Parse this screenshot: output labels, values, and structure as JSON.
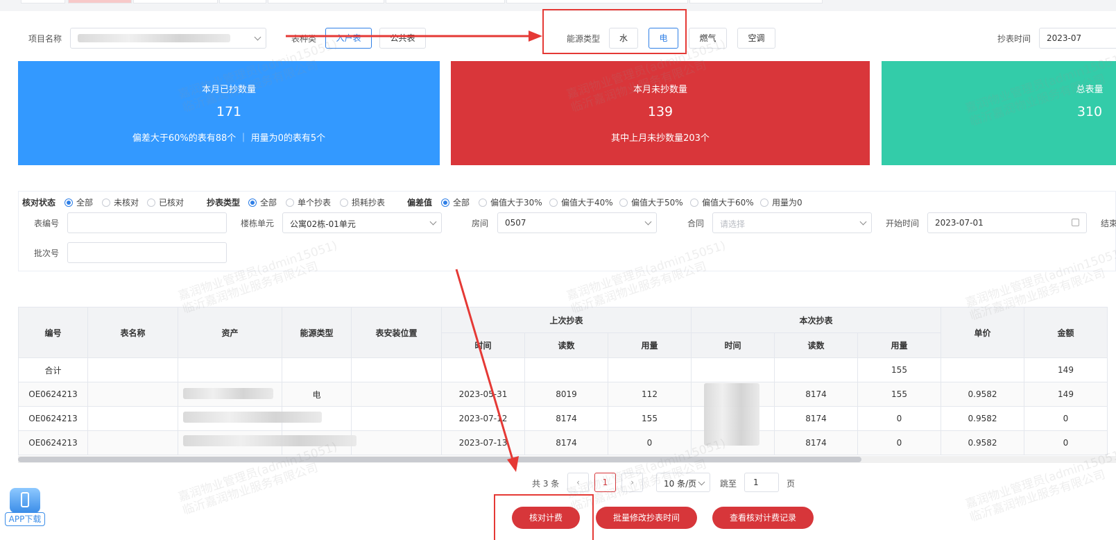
{
  "filters": {
    "project_label": "项目名称",
    "meter_kind_label": "表种类",
    "meter_kind_options": [
      "入户表",
      "公共表"
    ],
    "energy_type_label": "能源类型",
    "energy_options": [
      "水",
      "电",
      "燃气",
      "空调"
    ],
    "energy_selected": "电",
    "read_time_label": "抄表时间",
    "read_time_value": "2023-07"
  },
  "cards": {
    "read": {
      "title": "本月已抄数量",
      "value": "171",
      "sub": "偏差大于60%的表有88个 ｜ 用量为0的表有5个"
    },
    "unread": {
      "title": "本月未抄数量",
      "value": "139",
      "sub": "其中上月未抄数量203个"
    },
    "total": {
      "title": "总表量",
      "value": "310"
    }
  },
  "search": {
    "check_status_label": "核对状态",
    "check_status_options": [
      "全部",
      "未核对",
      "已核对"
    ],
    "read_type_label": "抄表类型",
    "read_type_options": [
      "全部",
      "单个抄表",
      "损耗抄表"
    ],
    "deviation_label": "偏差值",
    "deviation_options": [
      "全部",
      "偏值大于30%",
      "偏值大于40%",
      "偏值大于50%",
      "偏值大于60%",
      "用量为0"
    ],
    "meter_no_label": "表编号",
    "building_label": "楼栋单元",
    "building_value": "公寓02栋-01单元",
    "room_label": "房间",
    "room_value": "0507",
    "contract_label": "合同",
    "contract_placeholder": "请选择",
    "start_label": "开始时间",
    "start_value": "2023-07-01",
    "end_label": "结束",
    "batch_label": "批次号"
  },
  "table": {
    "headers": {
      "code": "编号",
      "name": "表名称",
      "asset": "资产",
      "energy": "能源类型",
      "location": "表安装位置",
      "prev": "上次抄表",
      "curr": "本次抄表",
      "time": "时间",
      "reading": "读数",
      "usage": "用量",
      "price": "单价",
      "amount": "金额"
    },
    "total_row": {
      "label": "合计",
      "curr_usage": "155",
      "amount": "149"
    },
    "rows": [
      {
        "code": "OE0624213",
        "energy": "电",
        "prev_time": "2023-05-31",
        "prev_reading": "8019",
        "prev_usage": "112",
        "curr_reading": "8174",
        "curr_usage": "155",
        "price": "0.9582",
        "amount": "149"
      },
      {
        "code": "OE0624213",
        "energy": "",
        "prev_time": "2023-07-12",
        "prev_reading": "8174",
        "prev_usage": "155",
        "curr_reading": "8174",
        "curr_usage": "0",
        "price": "0.9582",
        "amount": "0"
      },
      {
        "code": "OE0624213",
        "energy": "",
        "prev_time": "2023-07-13",
        "prev_reading": "8174",
        "prev_usage": "0",
        "curr_reading": "8174",
        "curr_usage": "0",
        "price": "0.9582",
        "amount": "0"
      }
    ]
  },
  "pagination": {
    "total": "共 3 条",
    "prev": "‹",
    "current": "1",
    "next": "›",
    "page_size": "10 条/页",
    "jump_label": "跳至",
    "jump_value": "1",
    "page_suffix": "页"
  },
  "actions": {
    "verify": "核对计费",
    "batch_edit": "批量修改抄表时间",
    "view_log": "查看核对计费记录"
  },
  "app_download": "APP下载",
  "watermark": {
    "line1": "嘉润物业管理员(admin15051)",
    "line2": "临沂嘉润物业服务有限公司"
  },
  "colors": {
    "blue": "#3399ff",
    "red": "#d9363a",
    "green": "#33cca9",
    "accent": "#e53935"
  }
}
